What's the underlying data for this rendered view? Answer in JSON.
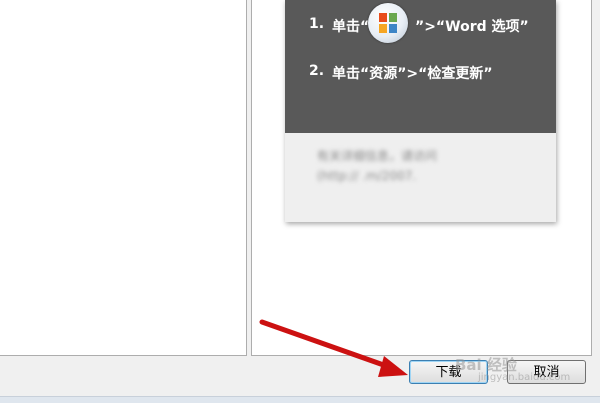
{
  "steps": [
    {
      "num": "1.",
      "text_before": "单击“",
      "text_after": "”>“Word 选项”"
    },
    {
      "num": "2.",
      "text": "单击“资源”>“检查更新”"
    }
  ],
  "info": {
    "line1": "有关详细信息，请访问",
    "line2": "(http://                  .m/2007."
  },
  "buttons": {
    "download": "下载",
    "cancel": "取消"
  },
  "watermark": {
    "main": "Bai 经验",
    "sub": "jingyan.baidu.com"
  },
  "icons": {
    "office_button": "office-logo-icon",
    "annotation": "red-arrow"
  },
  "colors": {
    "card_dark": "#595959",
    "arrow": "#cc1111",
    "logo_red": "#e84c1c",
    "logo_orange": "#f6a623",
    "logo_green": "#6aa84f",
    "logo_blue": "#3d85c6"
  }
}
